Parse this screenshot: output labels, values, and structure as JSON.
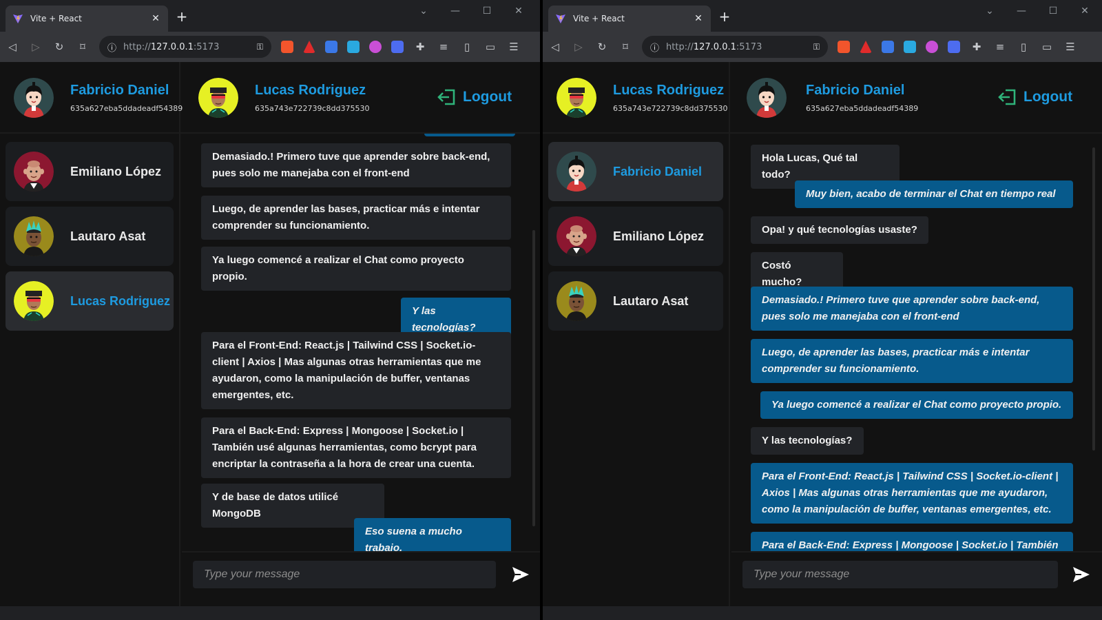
{
  "browser": {
    "tab_title": "Vite + React",
    "url_prefix": "http://",
    "url_host": "127.0.0.1",
    "url_port": ":5173",
    "new_tab": "+"
  },
  "left": {
    "me": {
      "name": "Fabricio Daniel",
      "id": "635a627eba5ddadeadf54389"
    },
    "active_contact": {
      "name": "Lucas Rodriguez",
      "id": "635a743e722739c8dd375530"
    },
    "logout_label": "Logout",
    "contacts": [
      {
        "name": "Emiliano López",
        "active": false
      },
      {
        "name": "Lautaro Asat",
        "active": false
      },
      {
        "name": "Lucas Rodriguez",
        "active": true
      }
    ],
    "messages": [
      {
        "text": "Demasiado.! Primero tuve que aprender sobre back-end, pues solo me manejaba con el front-end",
        "dir": "in"
      },
      {
        "text": "Luego, de aprender las bases, practicar más e intentar comprender su funcionamiento.",
        "dir": "in"
      },
      {
        "text": "Ya luego comencé a realizar el Chat como proyecto propio.",
        "dir": "in"
      },
      {
        "text": "Y las tecnologías?",
        "dir": "out"
      },
      {
        "text": "Para el Front-End: React.js | Tailwind CSS | Socket.io-client | Axios | Mas algunas otras herramientas que me ayudaron, como la manipulación de buffer, ventanas emergentes, etc.",
        "dir": "in"
      },
      {
        "text": "Para el Back-End: Express | Mongoose | Socket.io | También usé algunas herramientas, como bcrypt para encriptar la contraseña a la hora de crear una cuenta.",
        "dir": "in"
      },
      {
        "text": "Y de base de datos utilicé MongoDB",
        "dir": "in"
      },
      {
        "text": "Eso suena a mucho trabajo.",
        "dir": "out"
      }
    ],
    "input_placeholder": "Type your message"
  },
  "right": {
    "me": {
      "name": "Lucas Rodriguez",
      "id": "635a743e722739c8dd375530"
    },
    "active_contact": {
      "name": "Fabricio Daniel",
      "id": "635a627eba5ddadeadf54389"
    },
    "logout_label": "Logout",
    "contacts": [
      {
        "name": "Fabricio Daniel",
        "active": true
      },
      {
        "name": "Emiliano López",
        "active": false
      },
      {
        "name": "Lautaro Asat",
        "active": false
      }
    ],
    "messages": [
      {
        "text": "Hola Lucas, Qué tal todo?",
        "dir": "in"
      },
      {
        "text": "Muy bien, acabo de terminar el Chat en tiempo real",
        "dir": "out"
      },
      {
        "text": "Opa! y qué tecnologías usaste?",
        "dir": "in"
      },
      {
        "text": "Costó mucho?",
        "dir": "in"
      },
      {
        "text": "Demasiado.! Primero tuve que aprender sobre back-end, pues solo me manejaba con el front-end",
        "dir": "out"
      },
      {
        "text": "Luego, de aprender las bases, practicar más e intentar comprender su funcionamiento.",
        "dir": "out"
      },
      {
        "text": "Ya luego comencé a realizar el Chat como proyecto propio.",
        "dir": "out"
      },
      {
        "text": "Y las tecnologías?",
        "dir": "in"
      },
      {
        "text": "Para el Front-End: React.js | Tailwind CSS | Socket.io-client | Axios | Mas algunas otras herramientas que me ayudaron, como la manipulación de buffer, ventanas emergentes, etc.",
        "dir": "out"
      },
      {
        "text": "Para el Back-End: Express | Mongoose | Socket.io | También usé algunas herramientas, como bcrypt para encriptar la contraseña a la hora de crear una cuenta.",
        "dir": "out"
      }
    ],
    "input_placeholder": "Type your message"
  },
  "colors": {
    "accent": "#1e9be0",
    "outgoing": "#075a8c",
    "incoming": "#222428",
    "background": "#121212"
  }
}
